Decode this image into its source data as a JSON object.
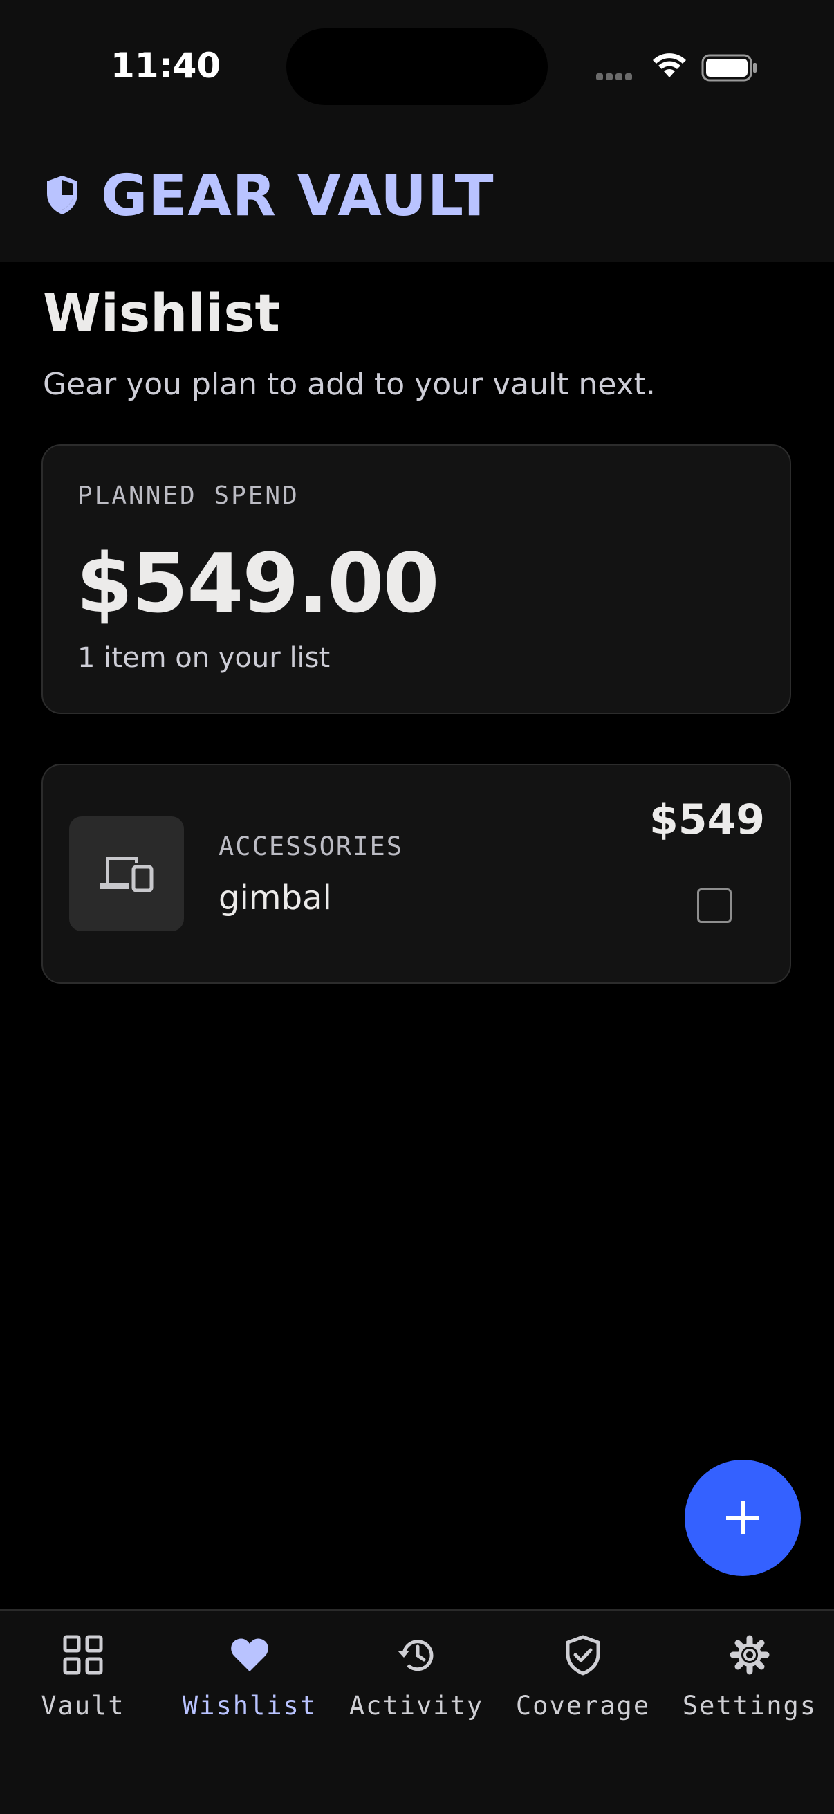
{
  "status_bar": {
    "time": "11:40"
  },
  "app": {
    "title": "GEAR VAULT"
  },
  "page": {
    "title": "Wishlist",
    "subtitle": "Gear you plan to add to your vault next."
  },
  "summary": {
    "label": "PLANNED SPEND",
    "amount": "$549.00",
    "count_text": "1 item on your list"
  },
  "items": [
    {
      "category": "ACCESSORIES",
      "name": "gimbal",
      "price": "$549",
      "checked": false,
      "icon": "devices-icon"
    }
  ],
  "fab": {
    "icon": "plus-icon"
  },
  "tabs": [
    {
      "label": "Vault",
      "icon": "grid-icon",
      "active": false
    },
    {
      "label": "Wishlist",
      "icon": "heart-icon",
      "active": true
    },
    {
      "label": "Activity",
      "icon": "history-icon",
      "active": false
    },
    {
      "label": "Coverage",
      "icon": "shield-check-icon",
      "active": false
    },
    {
      "label": "Settings",
      "icon": "gear-icon",
      "active": false
    }
  ],
  "colors": {
    "accent": "#b9c3ff",
    "fab": "#3461ff",
    "background": "#000000",
    "surface": "#131313"
  }
}
